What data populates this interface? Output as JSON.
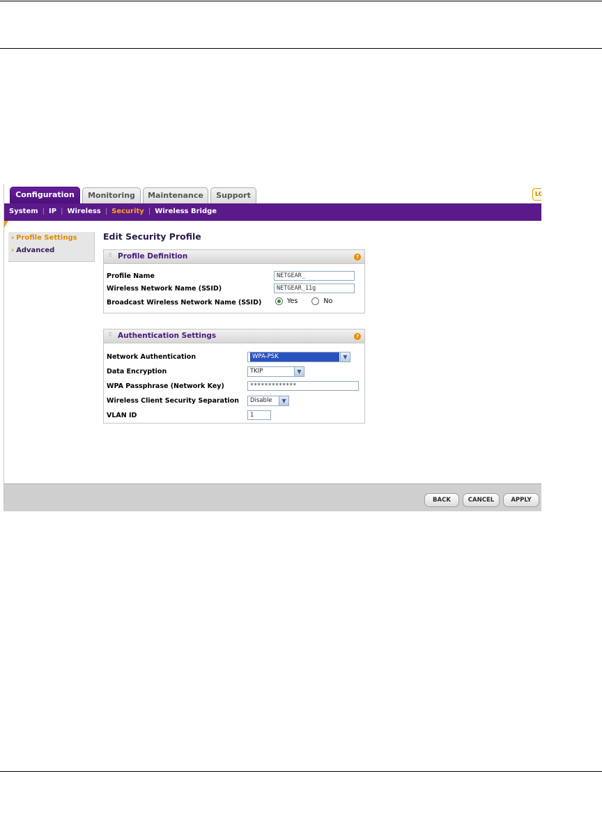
{
  "tabs": [
    {
      "label": "Configuration",
      "active": true
    },
    {
      "label": "Monitoring",
      "active": false
    },
    {
      "label": "Maintenance",
      "active": false
    },
    {
      "label": "Support",
      "active": false
    }
  ],
  "logout_stub": "LO",
  "subnav": {
    "items": [
      "System",
      "IP",
      "Wireless",
      "Security",
      "Wireless Bridge"
    ],
    "separator": "|",
    "active": "Security"
  },
  "sidebar": {
    "items": [
      {
        "label": "Profile Settings",
        "active": true
      },
      {
        "label": "Advanced",
        "active": false
      }
    ],
    "arrow": "›"
  },
  "page_title": "Edit Security Profile",
  "profile_definition": {
    "title": "Profile Definition",
    "help": "?",
    "profile_name_label": "Profile Name",
    "profile_name_value": "NETGEAR_",
    "ssid_label": "Wireless Network Name (SSID)",
    "ssid_value": "NETGEAR_11g",
    "broadcast_label": "Broadcast Wireless Network Name (SSID)",
    "broadcast_yes": "Yes",
    "broadcast_no": "No",
    "broadcast_selected": "Yes"
  },
  "authentication": {
    "title": "Authentication Settings",
    "help": "?",
    "network_auth_label": "Network Authentication",
    "network_auth_value": "WPA-PSK",
    "encryption_label": "Data Encryption",
    "encryption_value": "TKIP",
    "passphrase_label": "WPA Passphrase (Network Key)",
    "passphrase_value": "*************",
    "separation_label": "Wireless Client Security Separation",
    "separation_value": "Disable",
    "vlan_label": "VLAN ID",
    "vlan_value": "1"
  },
  "buttons": {
    "back": "BACK",
    "cancel": "CANCEL",
    "apply": "APPLY"
  },
  "colors": {
    "brand_purple": "#5a1a8a",
    "active_orange": "#ffa520",
    "selection_blue": "#2a52be"
  }
}
